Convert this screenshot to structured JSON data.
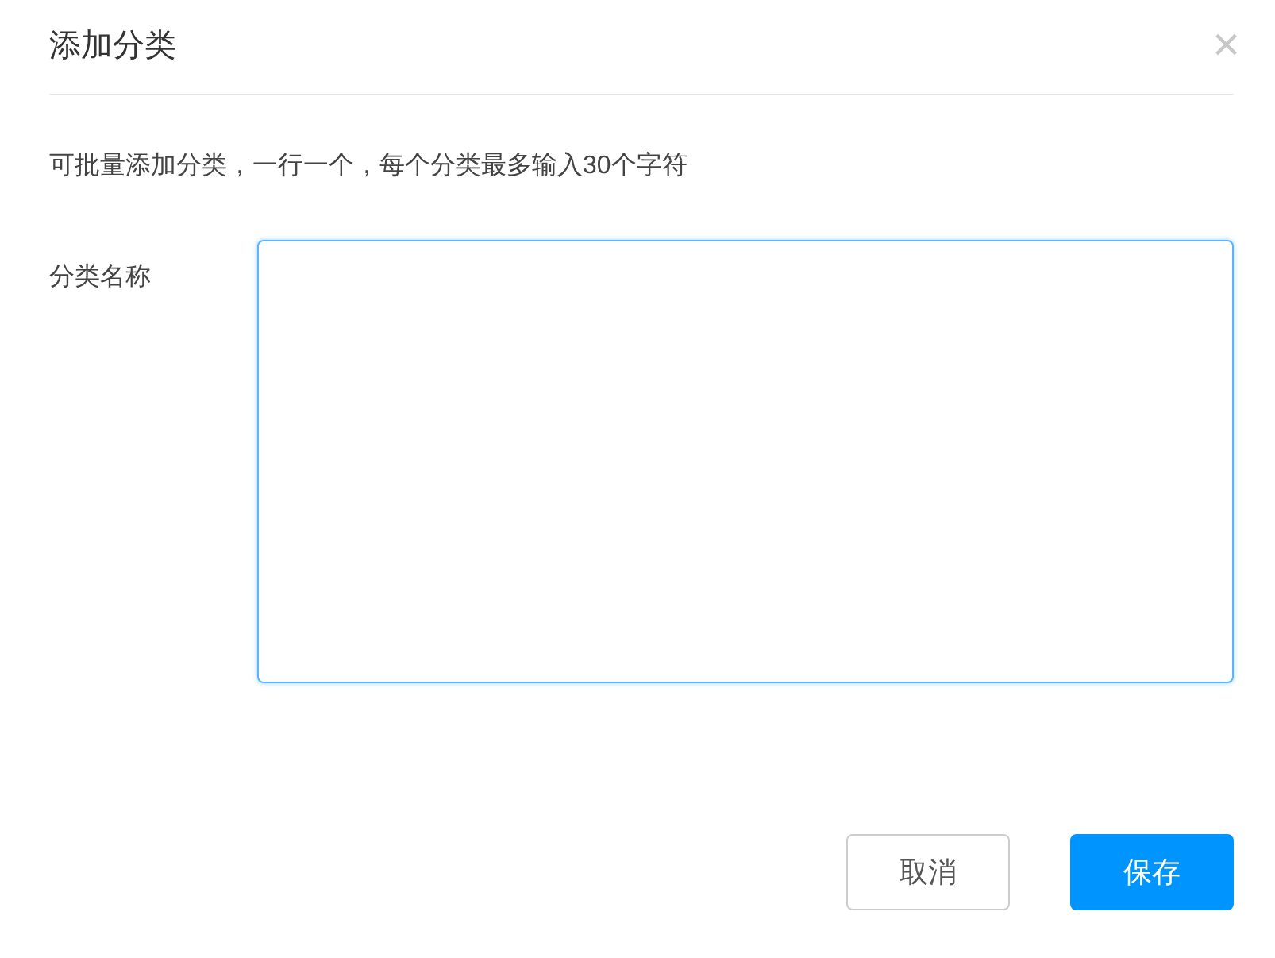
{
  "dialog": {
    "title": "添加分类",
    "close": "×"
  },
  "hint": "可批量添加分类，一行一个，每个分类最多输入30个字符",
  "field": {
    "label": "分类名称",
    "focused": true
  },
  "buttons": [
    {
      "label": "取消",
      "kind": "default"
    },
    {
      "label": "保存",
      "kind": "primary"
    }
  ]
}
